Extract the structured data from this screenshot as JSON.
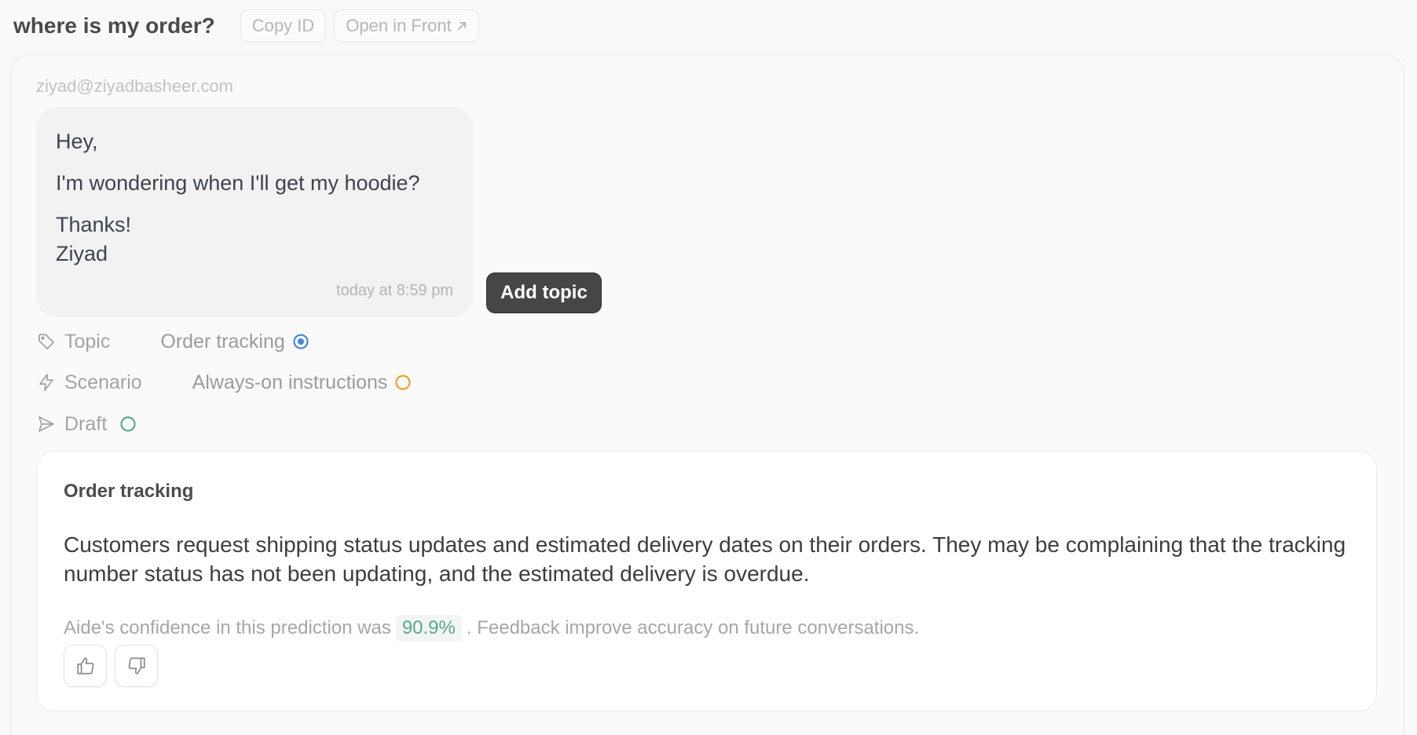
{
  "header": {
    "title": "where is my order?",
    "copy_id_label": "Copy ID",
    "open_front_label": "Open in Front",
    "open_front_icon": "arrow-up-right-icon"
  },
  "message": {
    "sender": "ziyad@ziyadbasheer.com",
    "greeting": "Hey,",
    "body": "I'm wondering when I'll get my hoodie?",
    "signoff": "Thanks!",
    "signature": "Ziyad",
    "timestamp": "today at 8:59 pm"
  },
  "actions": {
    "add_topic_label": "Add topic"
  },
  "properties": {
    "topic": {
      "label": "Topic",
      "icon": "tag-icon",
      "value": "Order tracking",
      "status_color": "#4a86d6"
    },
    "scenario": {
      "label": "Scenario",
      "icon": "lightning-icon",
      "value": "Always-on instructions",
      "status_color": "#e0a634"
    },
    "draft": {
      "label": "Draft",
      "icon": "send-icon",
      "status_color": "#5aa88a"
    }
  },
  "detail": {
    "title": "Order tracking",
    "description": "Customers request shipping status updates and estimated delivery dates on their orders. They may be complaining that the tracking number status has not been updating, and the estimated delivery is overdue.",
    "confidence_prefix": "Aide's confidence in this prediction was",
    "confidence_value": "90.9%",
    "confidence_suffix": ". Feedback improve accuracy on future conversations.",
    "thumbs_up_icon": "thumbs-up-icon",
    "thumbs_down_icon": "thumbs-down-icon"
  }
}
